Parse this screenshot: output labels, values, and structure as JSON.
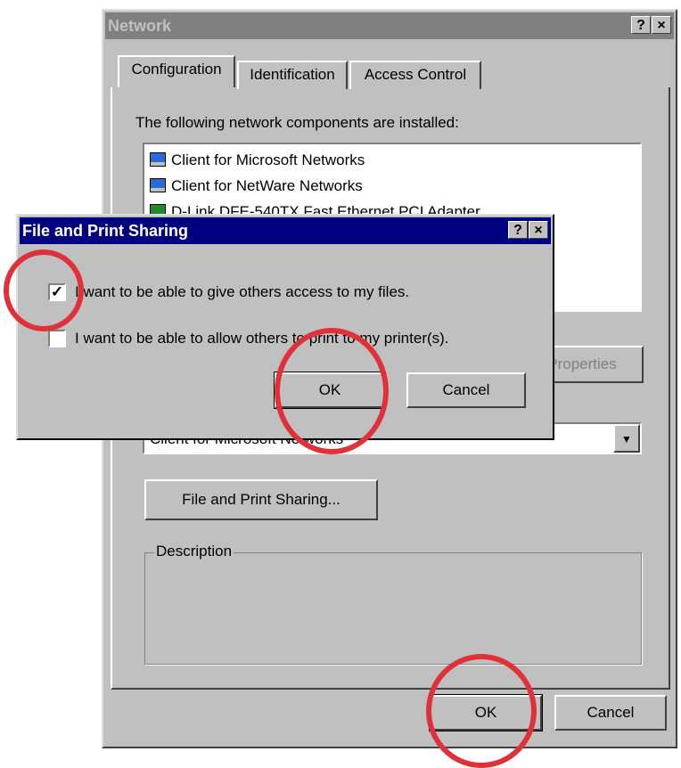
{
  "network": {
    "title": "Network",
    "help_glyph": "?",
    "close_glyph": "×",
    "tabs": [
      {
        "label": "Configuration"
      },
      {
        "label": "Identification"
      },
      {
        "label": "Access Control"
      }
    ],
    "installed_label": "The following network components are installed:",
    "components": [
      {
        "label": "Client for Microsoft Networks",
        "icon": "network-client-icon"
      },
      {
        "label": "Client for NetWare Networks",
        "icon": "network-client-icon"
      },
      {
        "label": "D-Link DFE-540TX Fast Ethernet PCI Adapter",
        "icon": "network-adapter-icon"
      }
    ],
    "properties_label": "Properties",
    "primary_logon_value": "Client for Microsoft Networks",
    "file_print_button": "File and Print Sharing...",
    "description_label": "Description",
    "ok_label": "OK",
    "cancel_label": "Cancel"
  },
  "sharing": {
    "title": "File and Print Sharing",
    "help_glyph": "?",
    "close_glyph": "×",
    "option_files": "I want to be able to give others access to my files.",
    "option_files_checked": true,
    "option_print": "I want to be able to allow others to print to my printer(s).",
    "option_print_checked": false,
    "ok_label": "OK",
    "cancel_label": "Cancel"
  },
  "annotations": {
    "highlight_color": "#e0303a"
  }
}
